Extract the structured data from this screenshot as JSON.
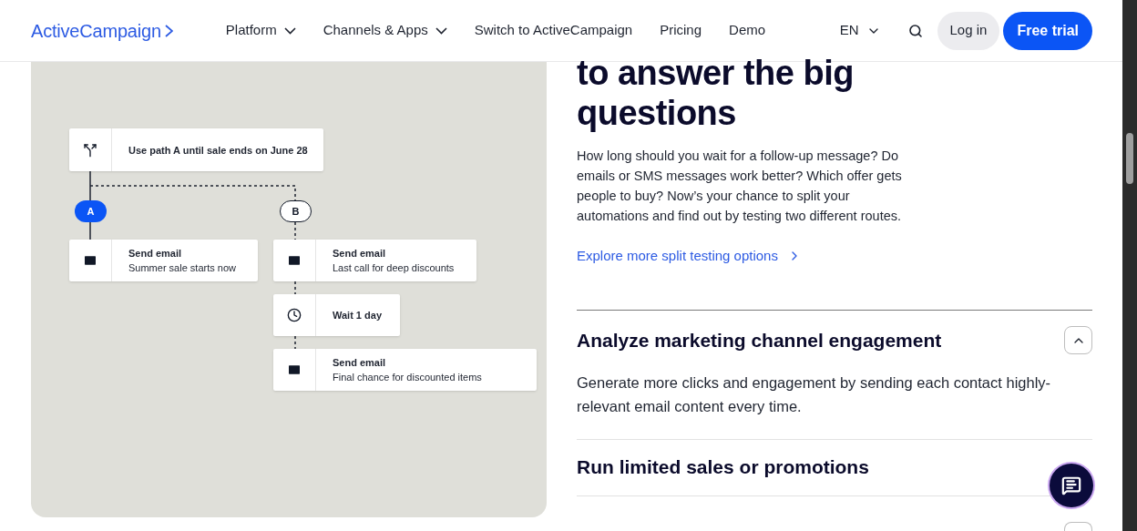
{
  "header": {
    "logo": "ActiveCampaign",
    "nav": [
      {
        "label": "Platform",
        "dropdown": true
      },
      {
        "label": "Channels & Apps",
        "dropdown": true
      },
      {
        "label": "Switch to ActiveCampaign",
        "dropdown": false
      },
      {
        "label": "Pricing",
        "dropdown": false
      },
      {
        "label": "Demo",
        "dropdown": false
      }
    ],
    "language": "EN",
    "login": "Log in",
    "cta": "Free trial"
  },
  "diagram": {
    "split": {
      "kind": "split",
      "title": "Use path A until sale ends on June 28"
    },
    "paths": [
      {
        "label": "A",
        "selected": true,
        "steps": [
          {
            "kind": "email",
            "title": "Send email",
            "subtitle": "Summer sale starts now"
          }
        ]
      },
      {
        "label": "B",
        "selected": false,
        "steps": [
          {
            "kind": "email",
            "title": "Send email",
            "subtitle": "Last call for deep discounts"
          },
          {
            "kind": "wait",
            "title": "Wait 1 day"
          },
          {
            "kind": "email",
            "title": "Send email",
            "subtitle": "Final chance for discounted items"
          }
        ]
      }
    ]
  },
  "section": {
    "heading_lines": [
      "to answer the big",
      "questions"
    ],
    "paragraph": "How long should you wait for a follow-up message? Do emails or SMS messages work better? Which offer gets people to buy? Now’s your chance to split your automations and find out by testing two different routes.",
    "link": "Explore more split testing options"
  },
  "accordion": [
    {
      "title": "Analyze marketing channel engagement",
      "expanded": true,
      "body": "Generate more clicks and engagement by sending each contact highly-relevant email content every time."
    },
    {
      "title": "Run limited sales or promotions",
      "expanded": false
    },
    {
      "expanded": false
    }
  ]
}
